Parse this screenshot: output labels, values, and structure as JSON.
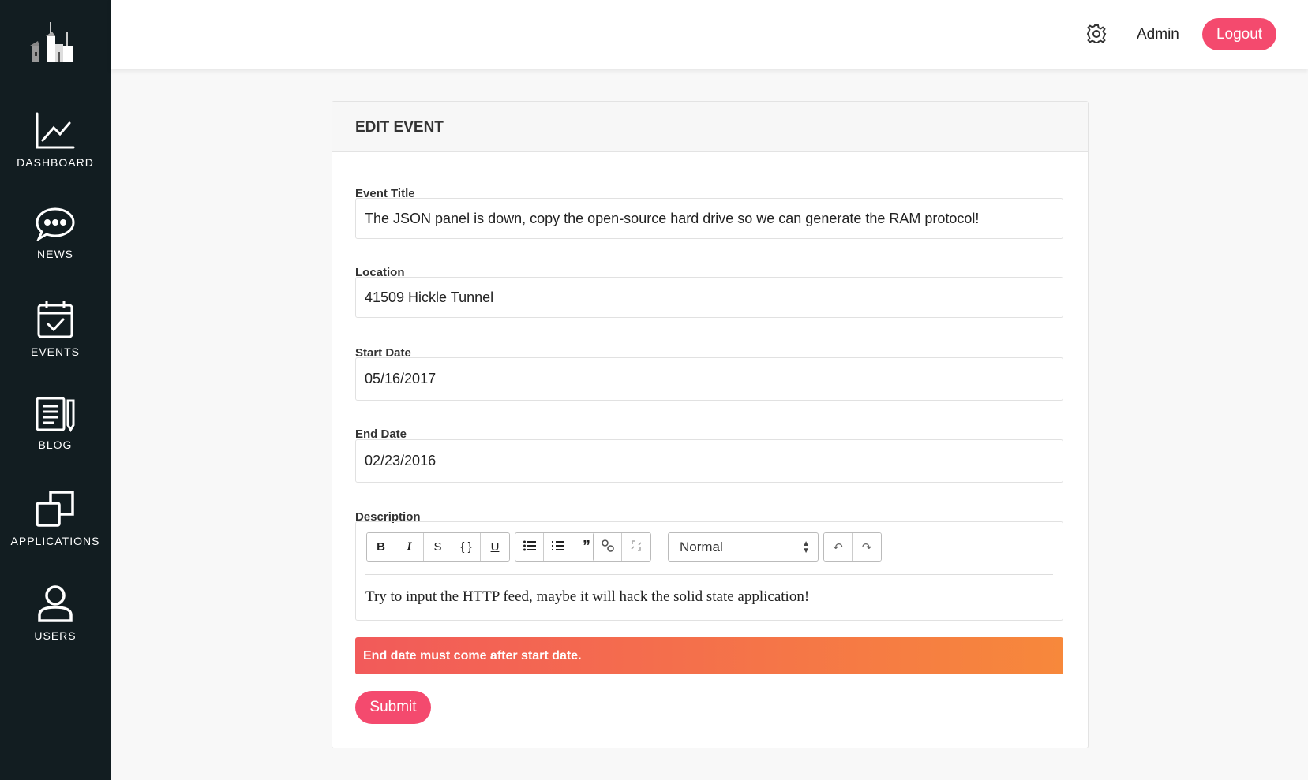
{
  "sidebar": {
    "items": [
      {
        "label": "DASHBOARD",
        "icon": "chart-line-icon"
      },
      {
        "label": "NEWS",
        "icon": "chat-bubble-icon"
      },
      {
        "label": "EVENTS",
        "icon": "calendar-check-icon"
      },
      {
        "label": "BLOG",
        "icon": "document-pencil-icon"
      },
      {
        "label": "APPLICATIONS",
        "icon": "windows-icon"
      },
      {
        "label": "USERS",
        "icon": "user-icon"
      }
    ]
  },
  "header": {
    "user": "Admin",
    "logout": "Logout"
  },
  "form": {
    "title": "EDIT EVENT",
    "event_title_label": "Event Title",
    "event_title": "The JSON panel is down, copy the open-source hard drive so we can generate the RAM protocol!",
    "location_label": "Location",
    "location": "41509 Hickle Tunnel",
    "start_label": "Start Date",
    "start": "05/16/2017",
    "end_label": "End Date",
    "end": "02/23/2016",
    "description_label": "Description",
    "format": "Normal",
    "description": "Try to input the HTTP feed, maybe it will hack the solid state application!",
    "error": "End date must come after start date.",
    "submit": "Submit"
  },
  "toolbar": {
    "bold": "B",
    "italic": "I",
    "strike": "S",
    "code": "{ }",
    "underline": "U"
  },
  "colors": {
    "sidebar": "#121d21",
    "accent": "#f44a6e",
    "alert_start": "#f25a5a",
    "alert_end": "#f7883b"
  }
}
